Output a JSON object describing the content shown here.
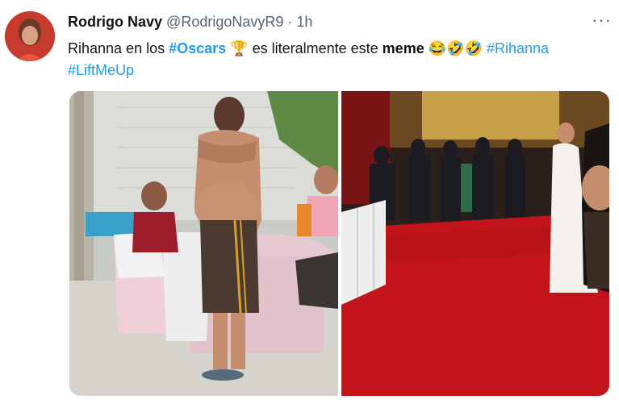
{
  "tweet": {
    "display_name": "Rodrigo Navy",
    "handle": "@RodrigoNavyR9",
    "separator": "·",
    "time": "1h",
    "more_label": "···",
    "text": {
      "part1": "Rihanna en los ",
      "hashtag_oscars": "#Oscars",
      "trophy": "🏆",
      "part2": " es literalmente este ",
      "meme": "meme",
      "emojis": "😂🤣🤣",
      "hashtag_rihanna": "#Rihanna",
      "hashtag_liftmeup": "#LiftMeUp"
    }
  },
  "media": {
    "left_image": "man-shirtless-event-photo",
    "right_image": "red-carpet-photo"
  },
  "colors": {
    "link": "#1d9bf0",
    "secondary": "#536471",
    "text": "#0f1419",
    "carpet": "#c3141b"
  }
}
